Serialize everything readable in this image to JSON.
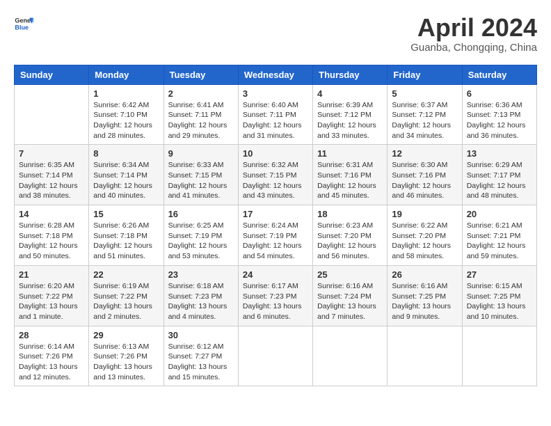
{
  "header": {
    "logo_general": "General",
    "logo_blue": "Blue",
    "month_title": "April 2024",
    "subtitle": "Guanba, Chongqing, China"
  },
  "weekdays": [
    "Sunday",
    "Monday",
    "Tuesday",
    "Wednesday",
    "Thursday",
    "Friday",
    "Saturday"
  ],
  "weeks": [
    [
      {
        "day": "",
        "info": ""
      },
      {
        "day": "1",
        "info": "Sunrise: 6:42 AM\nSunset: 7:10 PM\nDaylight: 12 hours\nand 28 minutes."
      },
      {
        "day": "2",
        "info": "Sunrise: 6:41 AM\nSunset: 7:11 PM\nDaylight: 12 hours\nand 29 minutes."
      },
      {
        "day": "3",
        "info": "Sunrise: 6:40 AM\nSunset: 7:11 PM\nDaylight: 12 hours\nand 31 minutes."
      },
      {
        "day": "4",
        "info": "Sunrise: 6:39 AM\nSunset: 7:12 PM\nDaylight: 12 hours\nand 33 minutes."
      },
      {
        "day": "5",
        "info": "Sunrise: 6:37 AM\nSunset: 7:12 PM\nDaylight: 12 hours\nand 34 minutes."
      },
      {
        "day": "6",
        "info": "Sunrise: 6:36 AM\nSunset: 7:13 PM\nDaylight: 12 hours\nand 36 minutes."
      }
    ],
    [
      {
        "day": "7",
        "info": "Sunrise: 6:35 AM\nSunset: 7:14 PM\nDaylight: 12 hours\nand 38 minutes."
      },
      {
        "day": "8",
        "info": "Sunrise: 6:34 AM\nSunset: 7:14 PM\nDaylight: 12 hours\nand 40 minutes."
      },
      {
        "day": "9",
        "info": "Sunrise: 6:33 AM\nSunset: 7:15 PM\nDaylight: 12 hours\nand 41 minutes."
      },
      {
        "day": "10",
        "info": "Sunrise: 6:32 AM\nSunset: 7:15 PM\nDaylight: 12 hours\nand 43 minutes."
      },
      {
        "day": "11",
        "info": "Sunrise: 6:31 AM\nSunset: 7:16 PM\nDaylight: 12 hours\nand 45 minutes."
      },
      {
        "day": "12",
        "info": "Sunrise: 6:30 AM\nSunset: 7:16 PM\nDaylight: 12 hours\nand 46 minutes."
      },
      {
        "day": "13",
        "info": "Sunrise: 6:29 AM\nSunset: 7:17 PM\nDaylight: 12 hours\nand 48 minutes."
      }
    ],
    [
      {
        "day": "14",
        "info": "Sunrise: 6:28 AM\nSunset: 7:18 PM\nDaylight: 12 hours\nand 50 minutes."
      },
      {
        "day": "15",
        "info": "Sunrise: 6:26 AM\nSunset: 7:18 PM\nDaylight: 12 hours\nand 51 minutes."
      },
      {
        "day": "16",
        "info": "Sunrise: 6:25 AM\nSunset: 7:19 PM\nDaylight: 12 hours\nand 53 minutes."
      },
      {
        "day": "17",
        "info": "Sunrise: 6:24 AM\nSunset: 7:19 PM\nDaylight: 12 hours\nand 54 minutes."
      },
      {
        "day": "18",
        "info": "Sunrise: 6:23 AM\nSunset: 7:20 PM\nDaylight: 12 hours\nand 56 minutes."
      },
      {
        "day": "19",
        "info": "Sunrise: 6:22 AM\nSunset: 7:20 PM\nDaylight: 12 hours\nand 58 minutes."
      },
      {
        "day": "20",
        "info": "Sunrise: 6:21 AM\nSunset: 7:21 PM\nDaylight: 12 hours\nand 59 minutes."
      }
    ],
    [
      {
        "day": "21",
        "info": "Sunrise: 6:20 AM\nSunset: 7:22 PM\nDaylight: 13 hours\nand 1 minute."
      },
      {
        "day": "22",
        "info": "Sunrise: 6:19 AM\nSunset: 7:22 PM\nDaylight: 13 hours\nand 2 minutes."
      },
      {
        "day": "23",
        "info": "Sunrise: 6:18 AM\nSunset: 7:23 PM\nDaylight: 13 hours\nand 4 minutes."
      },
      {
        "day": "24",
        "info": "Sunrise: 6:17 AM\nSunset: 7:23 PM\nDaylight: 13 hours\nand 6 minutes."
      },
      {
        "day": "25",
        "info": "Sunrise: 6:16 AM\nSunset: 7:24 PM\nDaylight: 13 hours\nand 7 minutes."
      },
      {
        "day": "26",
        "info": "Sunrise: 6:16 AM\nSunset: 7:25 PM\nDaylight: 13 hours\nand 9 minutes."
      },
      {
        "day": "27",
        "info": "Sunrise: 6:15 AM\nSunset: 7:25 PM\nDaylight: 13 hours\nand 10 minutes."
      }
    ],
    [
      {
        "day": "28",
        "info": "Sunrise: 6:14 AM\nSunset: 7:26 PM\nDaylight: 13 hours\nand 12 minutes."
      },
      {
        "day": "29",
        "info": "Sunrise: 6:13 AM\nSunset: 7:26 PM\nDaylight: 13 hours\nand 13 minutes."
      },
      {
        "day": "30",
        "info": "Sunrise: 6:12 AM\nSunset: 7:27 PM\nDaylight: 13 hours\nand 15 minutes."
      },
      {
        "day": "",
        "info": ""
      },
      {
        "day": "",
        "info": ""
      },
      {
        "day": "",
        "info": ""
      },
      {
        "day": "",
        "info": ""
      }
    ]
  ]
}
